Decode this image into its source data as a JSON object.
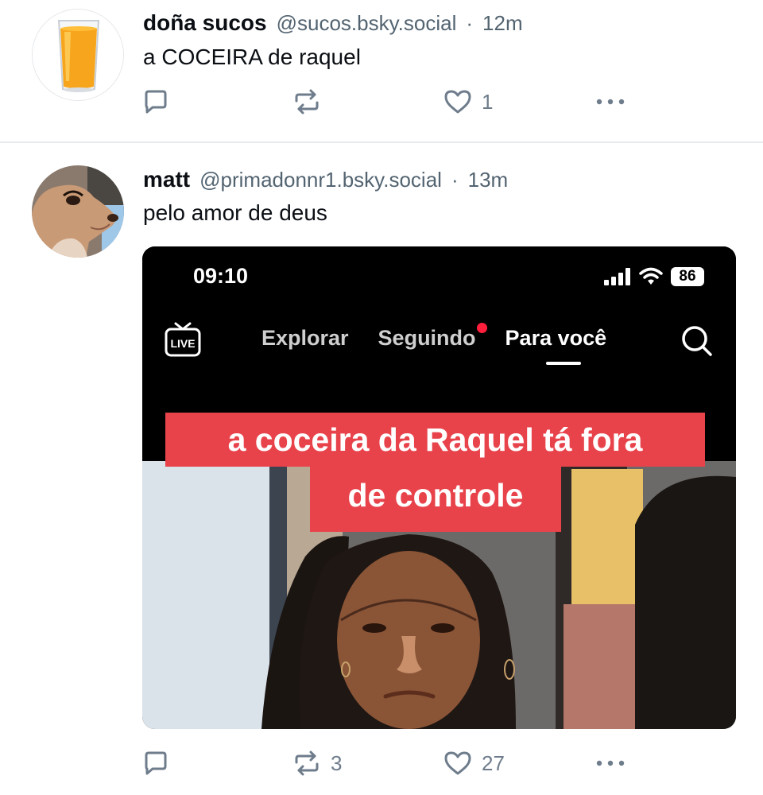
{
  "posts": [
    {
      "author": {
        "name": "doña sucos",
        "handle": "@sucos.bsky.social"
      },
      "time": "12m",
      "separator": "·",
      "text": "a COCEIRA de raquel",
      "stats": {
        "replies": "",
        "reposts": "",
        "likes": "1"
      }
    },
    {
      "author": {
        "name": "matt",
        "handle": "@primadonnr1.bsky.social"
      },
      "time": "13m",
      "separator": "·",
      "text": "pelo amor de deus",
      "stats": {
        "replies": "",
        "reposts": "3",
        "likes": "27"
      },
      "media": {
        "status_time": "09:10",
        "battery": "86",
        "live_label": "LIVE",
        "tabs": [
          "Explorar",
          "Seguindo",
          "Para você"
        ],
        "active_tab": "Para você",
        "caption_line1": "a coceira da Raquel tá fora",
        "caption_line2": "de controle"
      }
    }
  ],
  "icons": {
    "reply": "reply-icon",
    "repost": "repost-icon",
    "like": "heart-icon",
    "more": "more-icon",
    "live": "live-icon",
    "search": "search-icon"
  },
  "colors": {
    "text": "#0b0f14",
    "muted": "#536471",
    "action": "#6e7c8b",
    "caption_bg": "#e8434b",
    "notification_dot": "#ff1f3c"
  }
}
